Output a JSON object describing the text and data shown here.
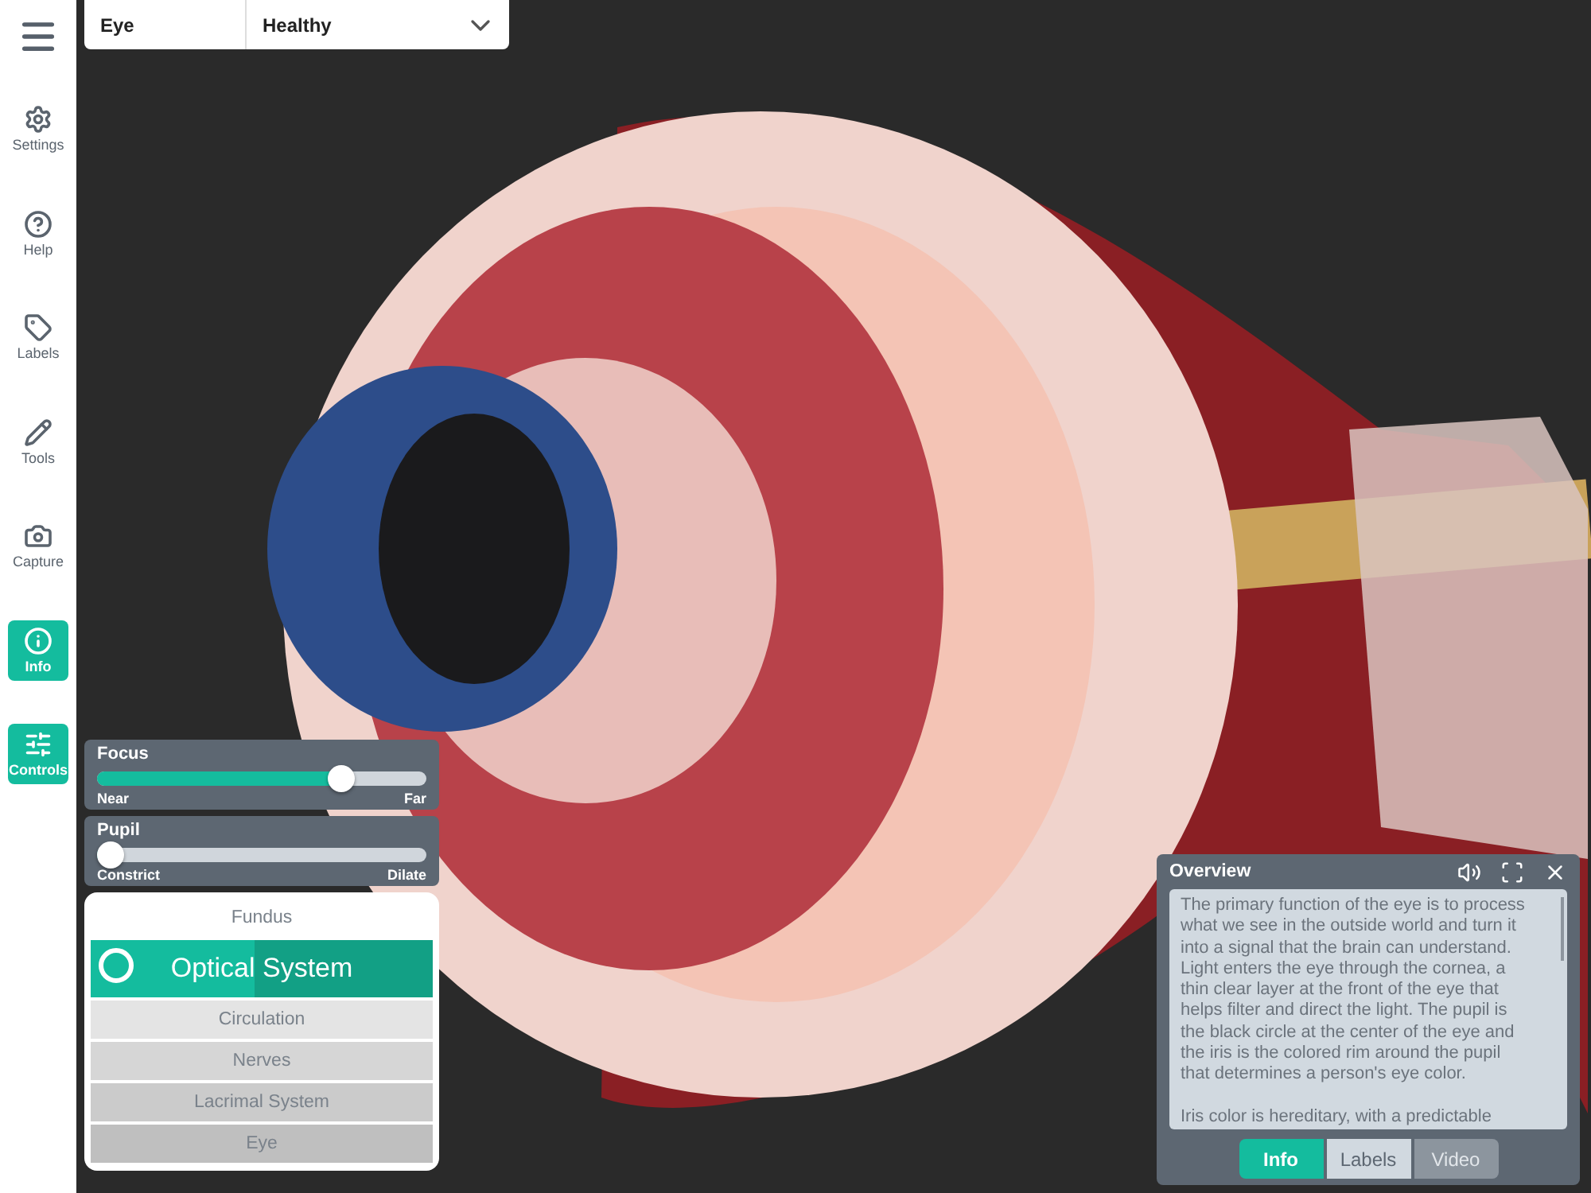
{
  "sidebar": {
    "items": [
      {
        "kind": "settings",
        "label": "Settings",
        "selected": false
      },
      {
        "kind": "help",
        "label": "Help",
        "selected": false
      },
      {
        "kind": "labels",
        "label": "Labels",
        "selected": false
      },
      {
        "kind": "tools",
        "label": "Tools",
        "selected": false
      },
      {
        "kind": "capture",
        "label": "Capture",
        "selected": false
      },
      {
        "kind": "info",
        "label": "Info",
        "selected": true
      },
      {
        "kind": "controls",
        "label": "Controls",
        "selected": true
      }
    ]
  },
  "model_selector": {
    "model": "Eye",
    "condition": "Healthy"
  },
  "sliders": [
    {
      "title": "Focus",
      "min_label": "Near",
      "max_label": "Far",
      "level": 0.74
    },
    {
      "title": "Pupil",
      "min_label": "Constrict",
      "max_label": "Dilate",
      "level": 0.04
    }
  ],
  "layers": [
    {
      "label": "Fundus",
      "selected": false
    },
    {
      "label": "Optical System",
      "selected": true
    },
    {
      "label": "Circulation",
      "selected": false
    },
    {
      "label": "Nerves",
      "selected": false
    },
    {
      "label": "Lacrimal System",
      "selected": false
    },
    {
      "label": "Eye",
      "selected": false
    }
  ],
  "overview": {
    "title": "Overview",
    "paragraphs": [
      "The primary function of the eye is to process what we see in the outside world and turn it into a signal that the brain can understand. Light enters the eye through the cornea, a thin clear layer at the front of the eye that helps filter and direct the light. The pupil is the black circle at the center of the eye and the iris is the colored rim around the pupil that determines a person's eye color.",
      "Iris color is hereditary, with a predictable"
    ],
    "tabs": [
      {
        "label": "Info",
        "selected": true,
        "disabled": false
      },
      {
        "label": "Labels",
        "selected": false,
        "disabled": false
      },
      {
        "label": "Video",
        "selected": false,
        "disabled": true
      }
    ]
  }
}
